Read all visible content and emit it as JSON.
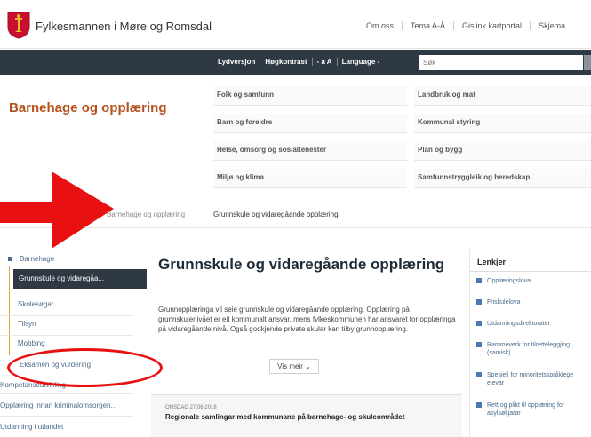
{
  "header": {
    "site_title": "Fylkesmannen i Møre og Romsdal",
    "top_links": [
      "Om oss",
      "Tema A-Å",
      "Gislink kartportal",
      "Skjema"
    ]
  },
  "toolbar": {
    "util_links": [
      "Lydversjon",
      "Høgkontrast",
      "- a A",
      "Language -"
    ],
    "search_placeholder": "Søk"
  },
  "section": {
    "title": "Barnehage og opplæring"
  },
  "menu": {
    "left": [
      "Folk og samfunn",
      "Barn og foreldre",
      "Helse, omsorg og sosialtenester",
      "Miljø og klima"
    ],
    "right": [
      "Landbruk og mat",
      "Kommunal styring",
      "Plan og bygg",
      "Samfunnstryggleik og beredskap"
    ]
  },
  "breadcrumb": [
    "Barnehage og opplæring",
    "Grunnskule og vidaregåande opplæring"
  ],
  "sidebar": {
    "items": [
      {
        "label": "Barnehage"
      },
      {
        "label": "Grunnskule og vidaregåa..."
      },
      {
        "label": "Skolesøgar"
      },
      {
        "label": "Tilsyn"
      },
      {
        "label": "Mobbing"
      },
      {
        "label": "Eksamen og vurdering"
      },
      {
        "label": "Kompetanseutvikling"
      },
      {
        "label": "Opplæring innan kriminalomsorgen..."
      },
      {
        "label": "Utdanning i utlandet"
      }
    ]
  },
  "main": {
    "title": "Grunnskule og vidaregåande opplæring",
    "intro": "Grunnopplæringa vil seie grunnskule og vidaregåande opplæring. Opplæring på grunnskulenivået er eit kommunalt ansvar, mens fylkeskommunen har ansvaret for opplæringa på vidaregåande nivå. Også godkjende private skular kan tilby grunnopplæring.",
    "read_more": "Vis meir",
    "news_date": "ONSDAG 27.06.2018",
    "news_title": "Regionale samlingar med kommunane på barnehage- og skuleområdet"
  },
  "links": {
    "title": "Lenkjer",
    "items": [
      "Opplæringslova",
      "Friskulelova",
      "Utdanningsdirektoratet",
      "Rammeverk for tilretteleggjing (samisk)",
      "Spesiell for minoritetsspråklege elevar",
      "Rett og plikt til opplæring for asylsøkjarar"
    ]
  }
}
